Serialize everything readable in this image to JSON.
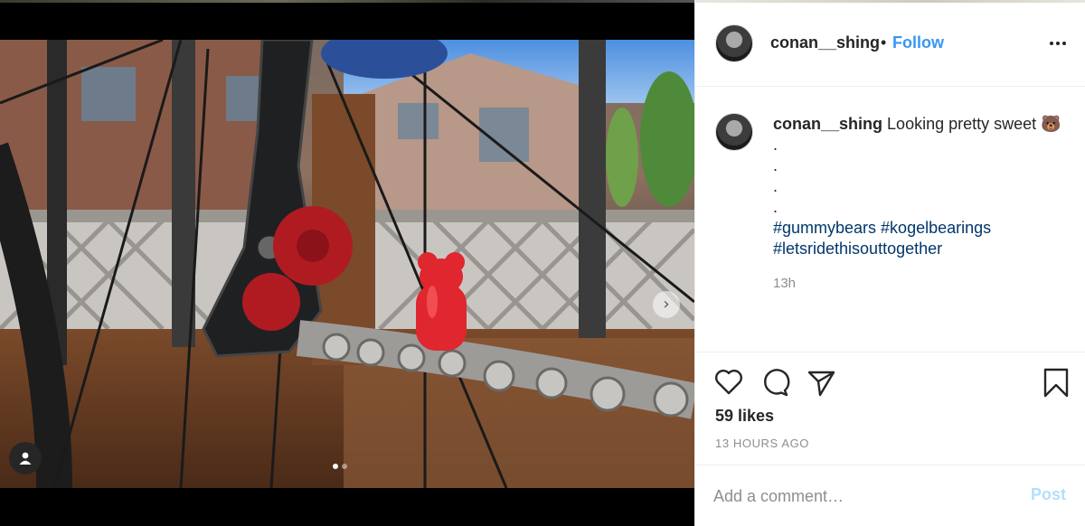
{
  "post": {
    "username": "conan__shing",
    "separator": "•",
    "follow_label": "Follow",
    "more_icon": "more-horizontal-icon",
    "caption_text": "Looking pretty sweet 🐻",
    "caption_dots": [
      ".",
      ".",
      ".",
      "."
    ],
    "hashtags_line1": "#gummybears #kogelbearings",
    "hashtags_line2": "#letsridethisouttogether",
    "caption_time": "13h",
    "likes": "59 likes",
    "posted_ago": "13 HOURS AGO",
    "comment_placeholder": "Add a comment…",
    "post_label": "Post",
    "carousel_next_glyph": "›",
    "carousel_slide_count": 2,
    "carousel_active_index": 0,
    "colors": {
      "follow": "#3897f0",
      "hashtag": "#00376b",
      "muted": "#8e8e8e",
      "post_disabled": "#b2dffc",
      "text": "#262626"
    },
    "icons": [
      "heart-icon",
      "comment-icon",
      "share-icon",
      "bookmark-icon",
      "user-tag-icon",
      "chevron-right-icon"
    ]
  }
}
